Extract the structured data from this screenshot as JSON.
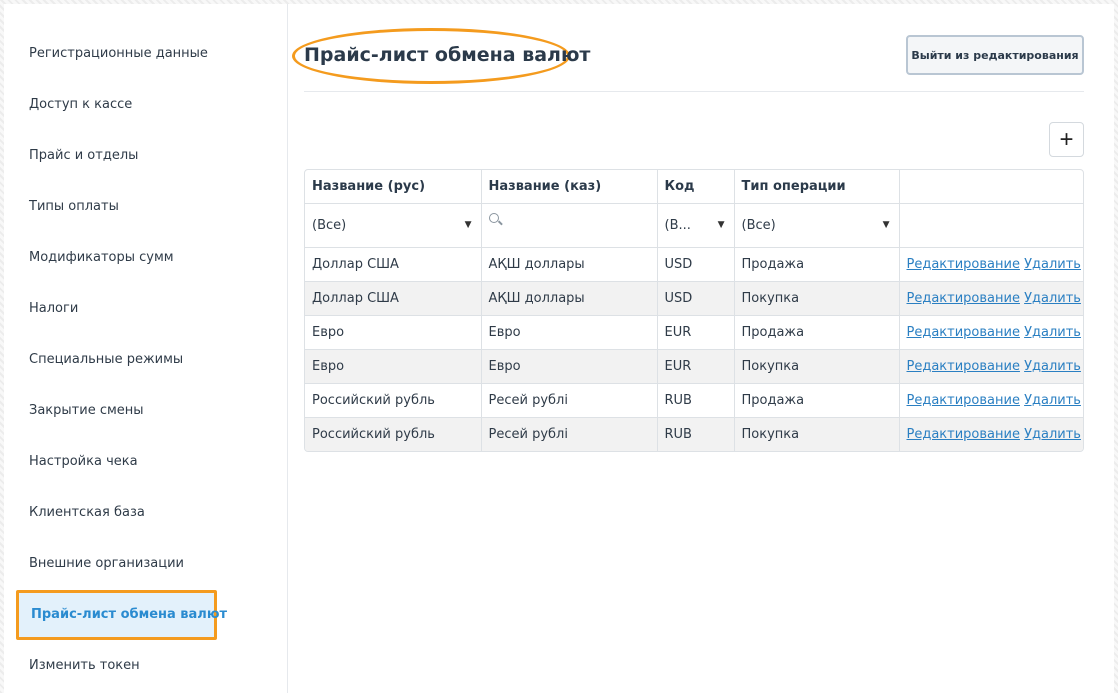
{
  "sidebar": {
    "items": [
      {
        "label": "Регистрационные данные",
        "active": false
      },
      {
        "label": "Доступ к кассе",
        "active": false
      },
      {
        "label": "Прайс и отделы",
        "active": false
      },
      {
        "label": "Типы оплаты",
        "active": false
      },
      {
        "label": "Модификаторы сумм",
        "active": false
      },
      {
        "label": "Налоги",
        "active": false
      },
      {
        "label": "Специальные режимы",
        "active": false
      },
      {
        "label": "Закрытие смены",
        "active": false
      },
      {
        "label": "Настройка чека",
        "active": false
      },
      {
        "label": "Клиентская база",
        "active": false
      },
      {
        "label": "Внешние организации",
        "active": false
      },
      {
        "label": "Прайс-лист обмена валют",
        "active": true
      },
      {
        "label": "Изменить токен",
        "active": false
      }
    ]
  },
  "header": {
    "title": "Прайс-лист обмена валют",
    "exit_label": "Выйти из редактирования",
    "add_label": "+"
  },
  "table": {
    "columns": [
      "Название (рус)",
      "Название (каз)",
      "Код",
      "Тип операции",
      ""
    ],
    "filters": {
      "name_ru": "(Все)",
      "name_kz": "",
      "code": "(В...",
      "operation": "(Все)"
    },
    "rows": [
      {
        "name_ru": "Доллар США",
        "name_kz": "АҚШ доллары",
        "code": "USD",
        "operation": "Продажа"
      },
      {
        "name_ru": "Доллар США",
        "name_kz": "АҚШ доллары",
        "code": "USD",
        "operation": "Покупка"
      },
      {
        "name_ru": "Евро",
        "name_kz": "Евро",
        "code": "EUR",
        "operation": "Продажа"
      },
      {
        "name_ru": "Евро",
        "name_kz": "Евро",
        "code": "EUR",
        "operation": "Покупка"
      },
      {
        "name_ru": "Российский рубль",
        "name_kz": "Ресей рублі",
        "code": "RUB",
        "operation": "Продажа"
      },
      {
        "name_ru": "Российский рубль",
        "name_kz": "Ресей рублі",
        "code": "RUB",
        "operation": "Покупка"
      }
    ],
    "edit_label": "Редактирование",
    "delete_label": "Удалить"
  },
  "colors": {
    "accent": "#2a8bd0",
    "highlight_outline": "#f49b1e",
    "link": "#2a7fc2"
  }
}
